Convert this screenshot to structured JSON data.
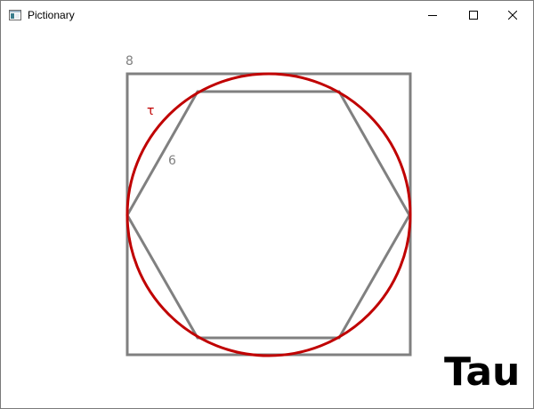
{
  "window": {
    "title": "Pictionary",
    "app_icon": "window-app-icon",
    "controls": {
      "minimize_icon": "minimize-icon",
      "maximize_icon": "maximize-icon",
      "close_icon": "close-icon"
    }
  },
  "drawing": {
    "square_label": "8",
    "hexagon_label": "6",
    "circle_label": "τ",
    "colors": {
      "square": "#808080",
      "hexagon": "#808080",
      "circle": "#c00000",
      "circle_label": "#c00000",
      "labels": "#808080"
    }
  },
  "answer": "Tau"
}
